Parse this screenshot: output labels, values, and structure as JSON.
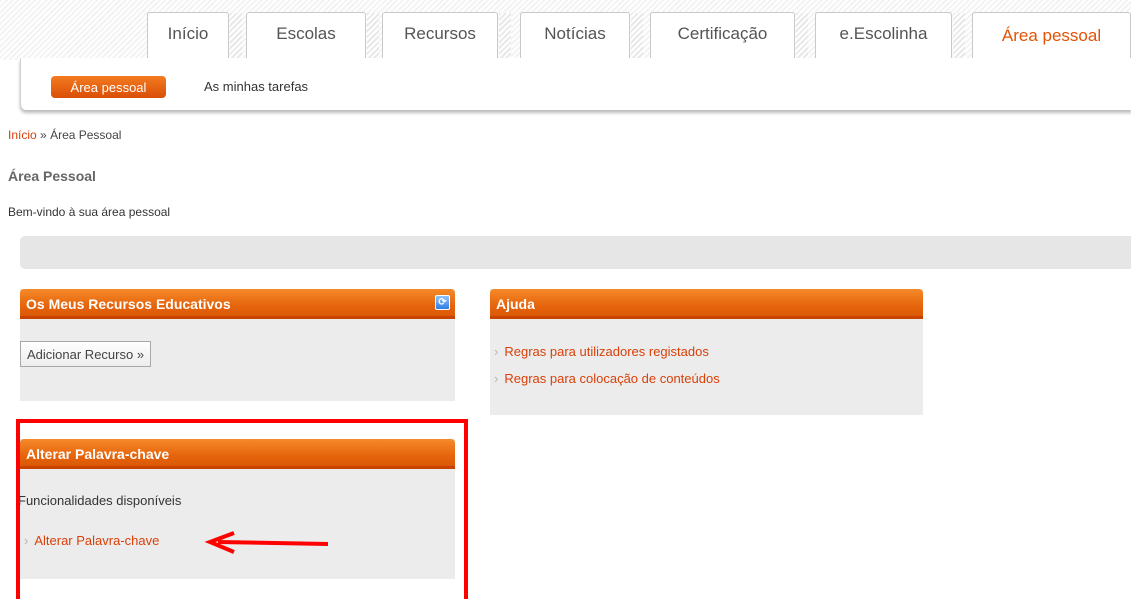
{
  "tabs": [
    "Início",
    "Escolas",
    "Recursos",
    "Notícias",
    "Certificação",
    "e.Escolinha",
    "Área pessoal"
  ],
  "subnav": {
    "active": "Área pessoal",
    "other": "As minhas tarefas"
  },
  "breadcrumb": {
    "home": "Início",
    "separator": "»",
    "current": "Área Pessoal"
  },
  "page_title": "Área Pessoal",
  "welcome": "Bem-vindo à sua área pessoal",
  "panels": {
    "resources": {
      "title": "Os Meus Recursos Educativos",
      "button": "Adicionar Recurso »",
      "refresh_icon": "refresh-icon"
    },
    "help": {
      "title": "Ajuda",
      "links": [
        "Regras para utilizadores registados",
        "Regras para colocação de conteúdos"
      ]
    },
    "password": {
      "title": "Alterar Palavra-chave",
      "subtitle": "Funcionalidades disponíveis",
      "link": "Alterar Palavra-chave"
    }
  },
  "colors": {
    "accent": "#e35205",
    "annotation": "#ff0000"
  }
}
